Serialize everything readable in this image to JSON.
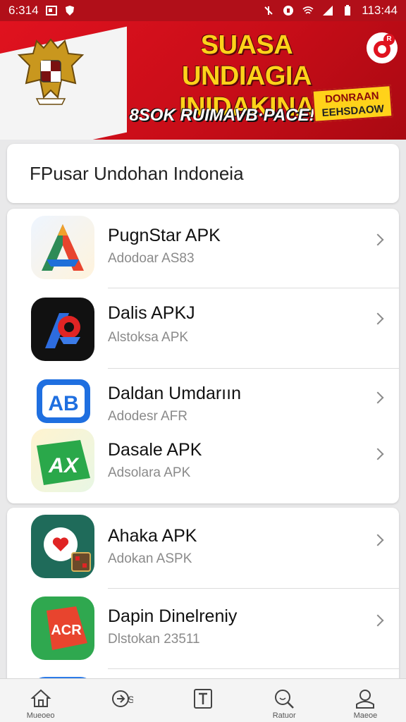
{
  "status_bar": {
    "time_left": "6:314",
    "time_right": "113:44"
  },
  "banner": {
    "headline_line1": "SUASA UNDIAGIA",
    "headline_line2": "INIDAKINA",
    "tagline": "8SOK RUIMAVB·PACE!",
    "promo_line1": "DONRAAN",
    "promo_line2": "EEHSDAOW",
    "badge_letter": "R"
  },
  "search": {
    "text": "FPusar Undohan Indoneia"
  },
  "apps": [
    {
      "title": "PugnStar APK",
      "subtitle": "Adodoar AS83",
      "icon": "colorful-a-icon"
    },
    {
      "title": "Dalis APKJ",
      "subtitle": "Alstoksa APK",
      "icon": "dark-a-icon"
    },
    {
      "title": "Daldan Umdarıın",
      "subtitle": "Adodesr AFR",
      "icon": "blue-ab-icon"
    },
    {
      "title": "Dasale APK",
      "subtitle": "Adsolara APK",
      "icon": "green-ax-icon"
    },
    {
      "title": "Ahaka APK",
      "subtitle": "Adokan ASPK",
      "icon": "heart-badge-icon"
    },
    {
      "title": "Dapin Dinelreniy",
      "subtitle": "Dlstokan 23511",
      "icon": "acr-icon"
    }
  ],
  "bottom_nav": [
    {
      "label": "Mueoeo",
      "icon": "home-icon"
    },
    {
      "label": "",
      "icon": "rocket-icon"
    },
    {
      "label": "",
      "icon": "t-box-icon"
    },
    {
      "label": "Ratuor",
      "icon": "search-icon"
    },
    {
      "label": "Maeoe",
      "icon": "profile-icon"
    }
  ]
}
